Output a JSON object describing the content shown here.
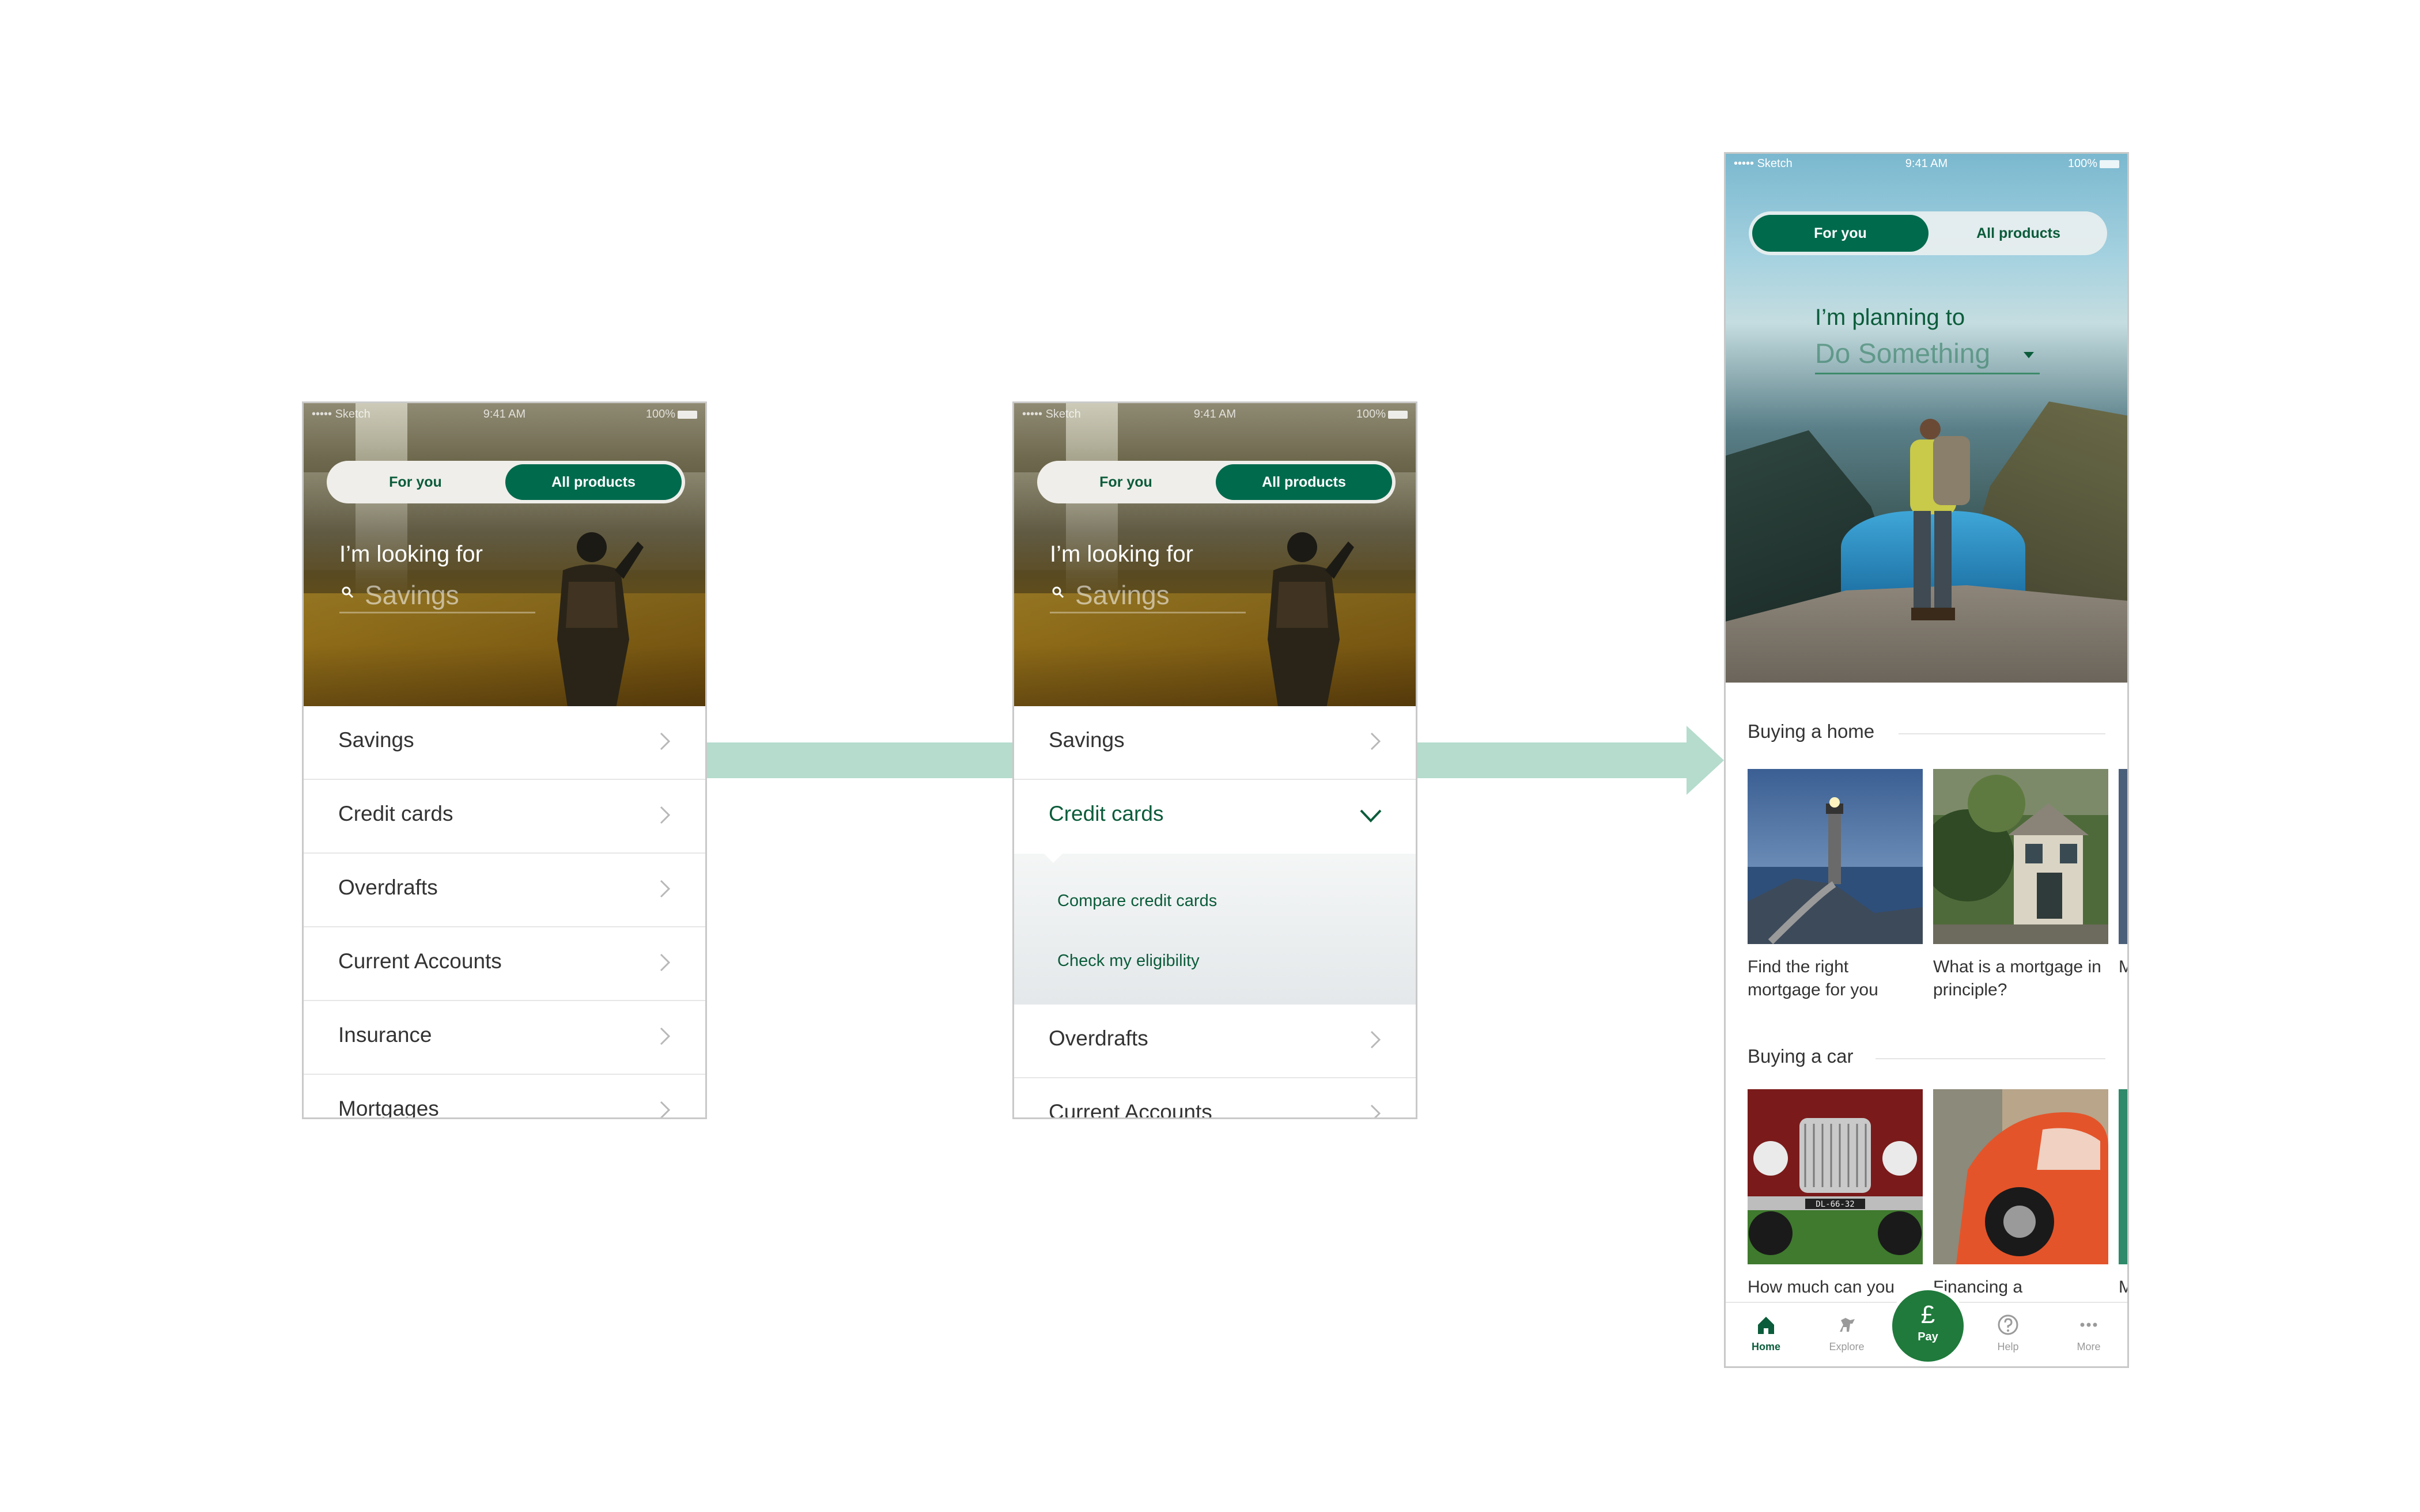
{
  "status_bar": {
    "carrier": "••••• Sketch",
    "time": "9:41 AM",
    "battery": "100%"
  },
  "colors": {
    "brand_green": "#006a4d",
    "text_green": "#0b5c3b",
    "arrow": "#b5dccd"
  },
  "screen1": {
    "toggle": {
      "for_you": "For you",
      "all_products": "All products",
      "active": "all_products"
    },
    "hero_title": "I’m looking for",
    "search_value": "Savings",
    "list": [
      "Savings",
      "Credit cards",
      "Overdrafts",
      "Current Accounts",
      "Insurance",
      "Mortgages"
    ]
  },
  "screen2": {
    "toggle": {
      "for_you": "For you",
      "all_products": "All products",
      "active": "all_products"
    },
    "hero_title": "I’m looking for",
    "search_value": "Savings",
    "list_top": "Savings",
    "expanded": "Credit cards",
    "sub_links": [
      "Compare credit cards",
      "Check my eligibility"
    ],
    "list_bottom": [
      "Overdrafts",
      "Current Accounts"
    ]
  },
  "screen3": {
    "toggle": {
      "for_you": "For you",
      "all_products": "All products",
      "active": "for_you"
    },
    "planning_title": "I’m planning to",
    "planning_value": "Do Something",
    "sections": [
      {
        "title": "Buying a home",
        "cards": [
          "Find the right mortgage for you",
          "What is a mortgage in principle?",
          "M"
        ]
      },
      {
        "title": "Buying a car",
        "cards": [
          "How much can you borrow?",
          "Financing a secondhand car",
          "M"
        ]
      }
    ],
    "plate": "DL-66-32",
    "tabs": {
      "home": "Home",
      "explore": "Explore",
      "pay_symbol": "£",
      "pay": "Pay",
      "help": "Help",
      "more": "More"
    }
  }
}
